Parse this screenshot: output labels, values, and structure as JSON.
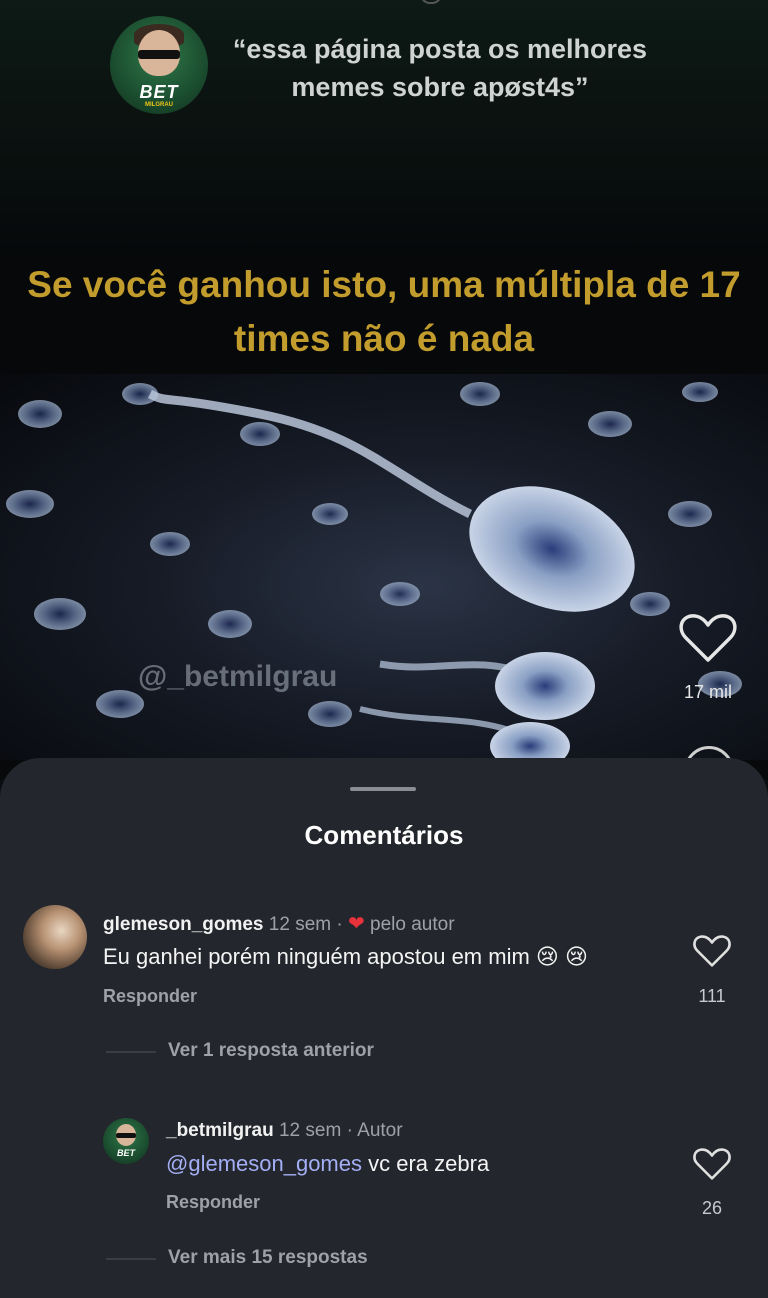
{
  "header": {
    "quote": "“essa página posta os melhores memes sobre apøst4s”",
    "avatar_text": "BET",
    "avatar_subtext": "MILGRAU"
  },
  "meme": {
    "caption": "Se você ganhou isto, uma múltipla de 17 times não é nada",
    "watermark": "@_betmilgrau"
  },
  "reel_actions": {
    "like_icon": "heart-outline-icon",
    "like_count": "17 mil"
  },
  "comments_sheet": {
    "title": "Comentários",
    "comments": [
      {
        "username": "glemeson_gomes",
        "time": "12 sem",
        "separator": "·",
        "badge_icon": "heart-filled-icon",
        "badge": "pelo autor",
        "text": "Eu ganhei porém ninguém apostou em mim 😢 😢",
        "reply_label": "Responder",
        "like_count": "111"
      }
    ],
    "view_previous": "Ver 1 resposta anterior",
    "replies": [
      {
        "username": "_betmilgrau",
        "avatar_text": "BET",
        "time": "12 sem",
        "separator": "·",
        "role": "Autor",
        "mention": "@glemeson_gomes",
        "text": "vc era zebra",
        "reply_label": "Responder",
        "like_count": "26"
      }
    ],
    "view_more": "Ver mais 15 respostas"
  },
  "colors": {
    "sheet_bg": "#23262c",
    "caption_gold": "#c29c2c",
    "mention_blue": "#a3aef5",
    "heart_red": "#e8323c"
  }
}
